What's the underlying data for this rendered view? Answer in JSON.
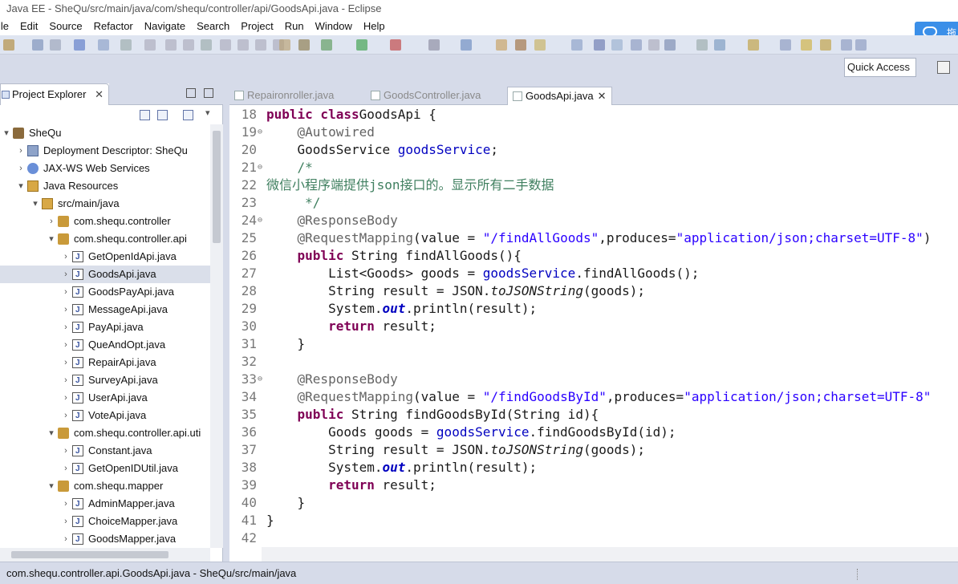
{
  "window": {
    "title": "Java EE - SheQu/src/main/java/com/shequ/controller/api/GoodsApi.java - Eclipse"
  },
  "menu": [
    "ile",
    "Edit",
    "Source",
    "Refactor",
    "Navigate",
    "Search",
    "Project",
    "Run",
    "Window",
    "Help"
  ],
  "app_button_label": "拖",
  "quick_access": "Quick Access",
  "explorer": {
    "tab_label": "Project Explorer",
    "tab_close": "✕",
    "tree": [
      {
        "label": "SheQu",
        "indent": 0,
        "arrow": "▾",
        "icon": "project"
      },
      {
        "label": "Deployment Descriptor: SheQu",
        "indent": 1,
        "arrow": "›",
        "icon": "dd"
      },
      {
        "label": "JAX-WS Web Services",
        "indent": 1,
        "arrow": "›",
        "icon": "jaxws"
      },
      {
        "label": "Java Resources",
        "indent": 1,
        "arrow": "▾",
        "icon": "src"
      },
      {
        "label": "src/main/java",
        "indent": 2,
        "arrow": "▾",
        "icon": "src"
      },
      {
        "label": "com.shequ.controller",
        "indent": 3,
        "arrow": "›",
        "icon": "pkg"
      },
      {
        "label": "com.shequ.controller.api",
        "indent": 3,
        "arrow": "▾",
        "icon": "pkg"
      },
      {
        "label": "GetOpenIdApi.java",
        "indent": 4,
        "arrow": "›",
        "icon": "java"
      },
      {
        "label": "GoodsApi.java",
        "indent": 4,
        "arrow": "›",
        "icon": "java",
        "selected": true
      },
      {
        "label": "GoodsPayApi.java",
        "indent": 4,
        "arrow": "›",
        "icon": "java"
      },
      {
        "label": "MessageApi.java",
        "indent": 4,
        "arrow": "›",
        "icon": "java"
      },
      {
        "label": "PayApi.java",
        "indent": 4,
        "arrow": "›",
        "icon": "java"
      },
      {
        "label": "QueAndOpt.java",
        "indent": 4,
        "arrow": "›",
        "icon": "java"
      },
      {
        "label": "RepairApi.java",
        "indent": 4,
        "arrow": "›",
        "icon": "java"
      },
      {
        "label": "SurveyApi.java",
        "indent": 4,
        "arrow": "›",
        "icon": "java"
      },
      {
        "label": "UserApi.java",
        "indent": 4,
        "arrow": "›",
        "icon": "java"
      },
      {
        "label": "VoteApi.java",
        "indent": 4,
        "arrow": "›",
        "icon": "java"
      },
      {
        "label": "com.shequ.controller.api.uti",
        "indent": 3,
        "arrow": "▾",
        "icon": "pkg"
      },
      {
        "label": "Constant.java",
        "indent": 4,
        "arrow": "›",
        "icon": "java"
      },
      {
        "label": "GetOpenIDUtil.java",
        "indent": 4,
        "arrow": "›",
        "icon": "java"
      },
      {
        "label": "com.shequ.mapper",
        "indent": 3,
        "arrow": "▾",
        "icon": "pkg"
      },
      {
        "label": "AdminMapper.java",
        "indent": 4,
        "arrow": "›",
        "icon": "java"
      },
      {
        "label": "ChoiceMapper.java",
        "indent": 4,
        "arrow": "›",
        "icon": "java"
      },
      {
        "label": "GoodsMapper.java",
        "indent": 4,
        "arrow": "›",
        "icon": "java"
      }
    ]
  },
  "editor": {
    "tabs": [
      {
        "label": "Repaironroller.java",
        "active": false
      },
      {
        "label": "GoodsController.java",
        "active": false
      },
      {
        "label": "GoodsApi.java",
        "active": true,
        "close": "✕"
      }
    ],
    "lines": [
      {
        "n": "18",
        "fold": "",
        "tokens": [
          [
            "kw",
            "public class"
          ],
          [
            "",
            "GoodsApi {"
          ]
        ]
      },
      {
        "n": "19",
        "fold": "⊖",
        "tokens": [
          [
            "",
            "    "
          ],
          [
            "ann",
            "@Autowired"
          ]
        ]
      },
      {
        "n": "20",
        "fold": "",
        "tokens": [
          [
            "",
            "    GoodsService "
          ],
          [
            "fld",
            "goodsService"
          ],
          [
            "",
            ";"
          ]
        ]
      },
      {
        "n": "21",
        "fold": "⊖",
        "tokens": [
          [
            "cmt",
            "    /*"
          ]
        ]
      },
      {
        "n": "22",
        "fold": "",
        "tokens": [
          [
            "cmt",
            "微信小程序端提供json接口的。显示所有二手数据"
          ]
        ]
      },
      {
        "n": "23",
        "fold": "",
        "tokens": [
          [
            "cmt",
            "     */"
          ]
        ]
      },
      {
        "n": "24",
        "fold": "⊖",
        "tokens": [
          [
            "",
            "    "
          ],
          [
            "ann",
            "@ResponseBody"
          ]
        ]
      },
      {
        "n": "25",
        "fold": "",
        "tokens": [
          [
            "",
            "    "
          ],
          [
            "ann",
            "@RequestMapping"
          ],
          [
            "",
            "(value = "
          ],
          [
            "str",
            "\"/findAllGoods\""
          ],
          [
            "",
            ",produces="
          ],
          [
            "str",
            "\"application/json;charset=UTF-8\""
          ],
          [
            "",
            ")"
          ]
        ]
      },
      {
        "n": "26",
        "fold": "",
        "tokens": [
          [
            "",
            "    "
          ],
          [
            "kw",
            "public"
          ],
          [
            "",
            " String findAllGoods(){"
          ]
        ]
      },
      {
        "n": "27",
        "fold": "",
        "tokens": [
          [
            "",
            "        List<Goods> goods = "
          ],
          [
            "fld",
            "goodsService"
          ],
          [
            "",
            ".findAllGoods();"
          ]
        ]
      },
      {
        "n": "28",
        "fold": "",
        "tokens": [
          [
            "",
            "        String result = JSON."
          ],
          [
            "ita",
            "toJSONString"
          ],
          [
            "",
            "(goods);"
          ]
        ]
      },
      {
        "n": "29",
        "fold": "",
        "tokens": [
          [
            "",
            "        System."
          ],
          [
            "stf",
            "out"
          ],
          [
            "",
            ".println(result);"
          ]
        ]
      },
      {
        "n": "30",
        "fold": "",
        "tokens": [
          [
            "",
            "        "
          ],
          [
            "kw",
            "return"
          ],
          [
            "",
            " result;"
          ]
        ]
      },
      {
        "n": "31",
        "fold": "",
        "tokens": [
          [
            "",
            "    }"
          ]
        ]
      },
      {
        "n": "32",
        "fold": "",
        "tokens": [
          [
            "",
            ""
          ]
        ]
      },
      {
        "n": "33",
        "fold": "⊖",
        "tokens": [
          [
            "",
            "    "
          ],
          [
            "ann",
            "@ResponseBody"
          ]
        ]
      },
      {
        "n": "34",
        "fold": "",
        "tokens": [
          [
            "",
            "    "
          ],
          [
            "ann",
            "@RequestMapping"
          ],
          [
            "",
            "(value = "
          ],
          [
            "str",
            "\"/findGoodsById\""
          ],
          [
            "",
            ",produces="
          ],
          [
            "str",
            "\"application/json;charset=UTF-8\""
          ]
        ]
      },
      {
        "n": "35",
        "fold": "",
        "tokens": [
          [
            "",
            "    "
          ],
          [
            "kw",
            "public"
          ],
          [
            "",
            " String findGoodsById(String id){"
          ]
        ]
      },
      {
        "n": "36",
        "fold": "",
        "tokens": [
          [
            "",
            "        Goods goods = "
          ],
          [
            "fld",
            "goodsService"
          ],
          [
            "",
            ".findGoodsById(id);"
          ]
        ]
      },
      {
        "n": "37",
        "fold": "",
        "tokens": [
          [
            "",
            "        String result = JSON."
          ],
          [
            "ita",
            "toJSONString"
          ],
          [
            "",
            "(goods);"
          ]
        ]
      },
      {
        "n": "38",
        "fold": "",
        "tokens": [
          [
            "",
            "        System."
          ],
          [
            "stf",
            "out"
          ],
          [
            "",
            ".println(result);"
          ]
        ]
      },
      {
        "n": "39",
        "fold": "",
        "tokens": [
          [
            "",
            "        "
          ],
          [
            "kw",
            "return"
          ],
          [
            "",
            " result;"
          ]
        ]
      },
      {
        "n": "40",
        "fold": "",
        "tokens": [
          [
            "",
            "    }"
          ]
        ]
      },
      {
        "n": "41",
        "fold": "",
        "tokens": [
          [
            "",
            "}"
          ]
        ]
      },
      {
        "n": "42",
        "fold": "",
        "tokens": [
          [
            "",
            ""
          ]
        ]
      }
    ]
  },
  "status": "com.shequ.controller.api.GoodsApi.java - SheQu/src/main/java"
}
